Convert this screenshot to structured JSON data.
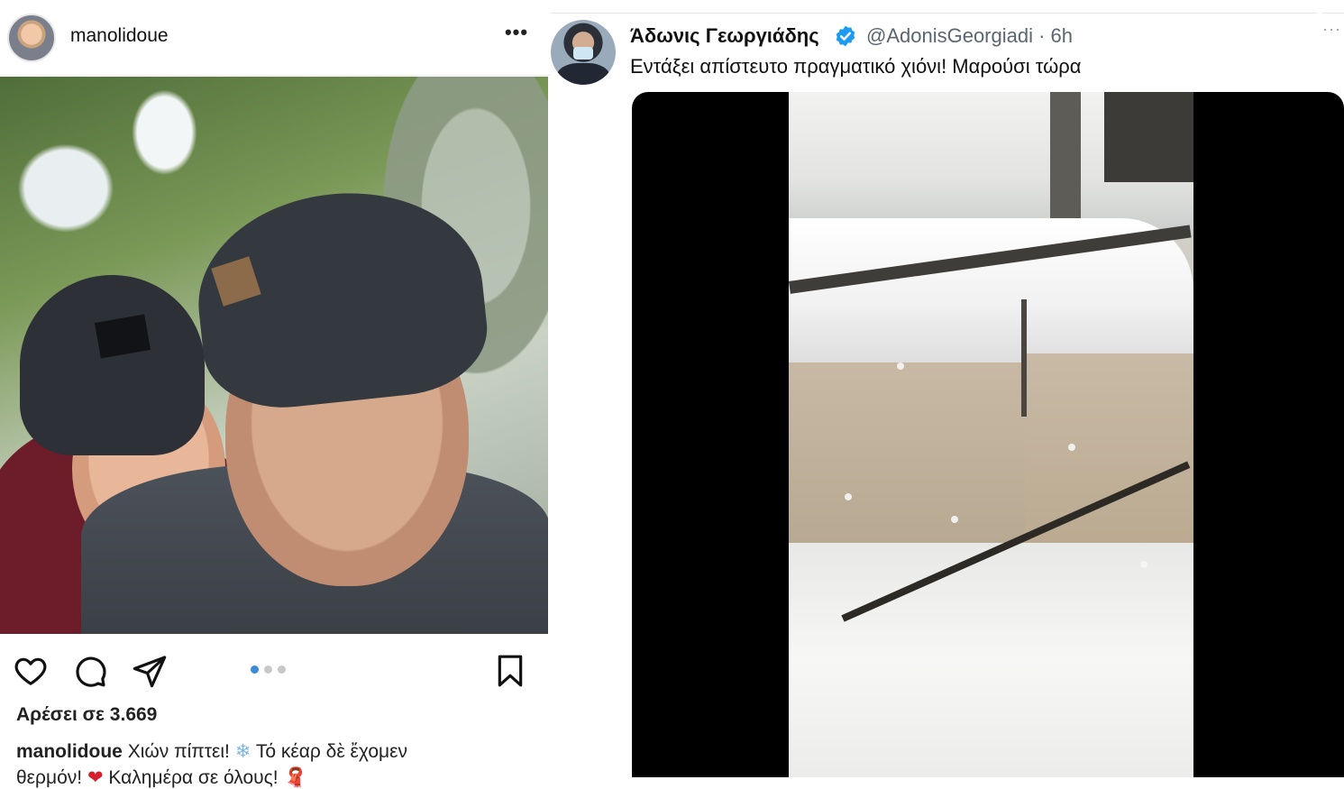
{
  "instagram": {
    "username": "manolidoue",
    "more_label": "•••",
    "likes": "Αρέσει σε 3.669",
    "caption": {
      "username": "manolidoue",
      "line1_text": "Χιών πίπτει!",
      "line1_emoji": "❄",
      "line1_text2": "Τό κέαρ δὲ ἔχομεν",
      "line2_text": "θερμόν!",
      "line2_emoji": "❤",
      "line2_text2": "Καλημέρα σε όλους!",
      "line2_emoji2": "🧣"
    },
    "carousel": {
      "total": 3,
      "active_index": 0
    },
    "icons": [
      "heart-icon",
      "comment-icon",
      "share-icon",
      "bookmark-icon"
    ]
  },
  "twitter": {
    "name": "Άδωνις Γεωργιάδης",
    "handle_time": "@AdonisGeorgiadi · 6h",
    "text": "Εντάξει απίστευτο πραγματικό χιόνι! Μαρούσι τώρα",
    "more_label": "···",
    "verified_color": "#1d9bf0"
  }
}
